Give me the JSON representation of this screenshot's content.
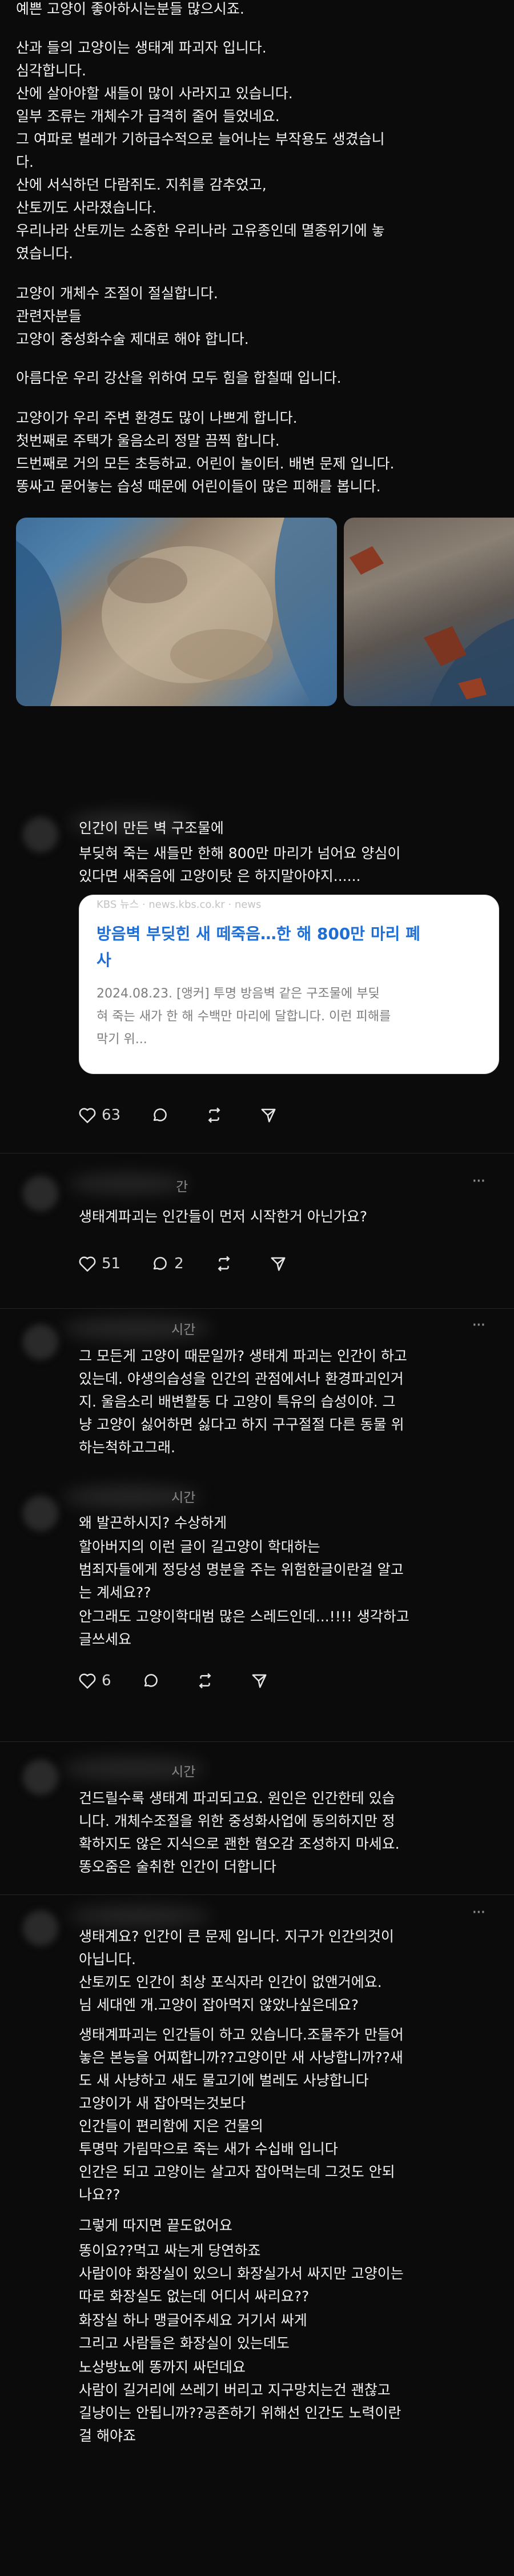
{
  "post": {
    "lines": [
      "예쁜 고양이 좋아하시는분들 많으시죠.",
      "산과 들의 고양이는 생태계 파괴자 입니다.",
      "심각합니다.",
      "산에 살아야할 새들이 많이 사라지고 있습니다.",
      "일부 조류는 개체수가 급격히 줄어 들었네요.",
      "그 여파로 벌레가 기하급수적으로 늘어나는 부작용도 생겼습니",
      "다.",
      "산에 서식하던 다람쥐도. 지취를 감추었고,",
      "산토끼도 사라졌습니다.",
      "우리나라 산토끼는 소중한 우리나라 고유종인데 멸종위기에 놓",
      "였습니다.",
      "고양이 개체수 조절이 절실합니다.",
      "관련자분들",
      "고양이 중성화수술 제대로 해야 합니다.",
      "아름다운 우리 강산을 위하여 모두 힘을 합칠때 입니다.",
      "고양이가 우리 주변 환경도 많이 나쁘게 합니다.",
      "첫번째로 주택가 울음소리 정말 끔찍 합니다.",
      "드번째로 거의 모든 초등하교. 어린이 놀이터. 배변 문제 입니다.",
      "똥싸고 묻어놓는 습성 때문에 어린이들이 많은 피해를 봅니다."
    ]
  },
  "reply1": {
    "lines": [
      "인간이 만든 벽 구조물에",
      "부딪혀 죽는 새들만 한해 800만 마리가 넘어요 양심이",
      "있다면 새죽음에 고양이탓 은 하지말아야지......"
    ],
    "card": {
      "source": "KBS 뉴스 · news.kbs.co.kr · news",
      "title_line1": "방음벽 부딪힌 새 떼죽음…한 해 800만 마리 폐",
      "title_line2": "사",
      "snippet_line1": "2024.08.23.  [앵커] 투명 방음벽 같은 구조물에 부딪",
      "snippet_line2": "혀 죽는 새가 한 해 수백만 마리에 달합니다. 이런 피해를",
      "snippet_line3": "막기 위..."
    },
    "likes": "63"
  },
  "reply2": {
    "time": "간",
    "lines": [
      "생태계파괴는 인간들이 먼저 시작한거 아닌가요?"
    ],
    "likes": "51",
    "comments": "2"
  },
  "reply3": {
    "time": "시간",
    "lines": [
      "그 모든게 고양이 때문일까? 생태계 파괴는 인간이 하고",
      "있는데. 야생의습성을 인간의 관점에서나 환경파괴인거",
      "지. 울음소리 배변활동 다 고양이 특유의 습성이야. 그",
      "냥 고양이 싫어하면 싫다고 하지 구구절절 다른 동물 위",
      "하는척하고그래."
    ]
  },
  "reply4": {
    "time": "시간",
    "lines": [
      "왜 발끈하시지? 수상하게",
      "할아버지의 이런 글이 길고양이 학대하는",
      "범죄자들에게 정당성 명분을 주는 위험한글이란걸 알고",
      "는 계세요??",
      "안그래도 고양이학대범 많은 스레드인데...!!!! 생각하고",
      "글쓰세요"
    ],
    "likes": "6"
  },
  "reply5": {
    "time": "시간",
    "lines": [
      "건드릴수록 생태계 파괴되고요. 원인은 인간한테 있습",
      "니다. 개체수조절을 위한 중성화사업에 동의하지만 정",
      "확하지도 않은 지식으로 괜한 혐오감 조성하지 마세요.",
      "똥오줌은 술취한 인간이 더합니다"
    ]
  },
  "reply6": {
    "lines": [
      "생태계요? 인간이 큰 문제 입니다. 지구가 인간의것이",
      "아닙니다.",
      "산토끼도 인간이 최상 포식자라 인간이 없앤거에요.",
      "님 세대엔 개.고양이 잡아먹지 않았나싶은데요?",
      "생태계파괴는 인간들이 하고 있습니다.조물주가 만들어",
      "놓은 본능을 어찌합니까??고양이만 새 사냥합니까??새",
      "도 새 사냥하고 새도 물고기에 벌레도 사냥합니다",
      "고양이가 새 잡아먹는것보다",
      "인간들이 편리함에 지은 건물의",
      "투명막 가림막으로 죽는 새가 수십배 입니다",
      "인간은 되고 고양이는 살고자 잡아먹는데 그것도 안되",
      "나요??",
      "그렇게 따지면 끝도없어요",
      "똥이요??먹고 싸는게 당연하죠",
      "사람이야 화장실이 있으니 화장실가서 싸지만 고양이는",
      "따로 화장실도 없는데 어디서 싸리요??",
      "화장실 하나 맹글어주세요 거기서 싸게",
      "그리고 사람들은 화장실이 있는데도",
      "노상방뇨에 똥까지 싸던데요",
      "사람이 길거리에 쓰레기 버리고 지구망치는건 괜찮고",
      "길냥이는 안됩니까??공존하기 위해선 인간도 노력이란",
      "걸 해야죠"
    ]
  },
  "icons": {
    "like": "heart-icon",
    "comment": "comment-icon",
    "repost": "repost-icon",
    "share": "share-icon",
    "more": "more-icon"
  },
  "colors": {
    "background": "#0b0b0b",
    "text": "#f3f3f3",
    "muted": "#8c8c8c",
    "link_title": "#1d6fd6"
  }
}
